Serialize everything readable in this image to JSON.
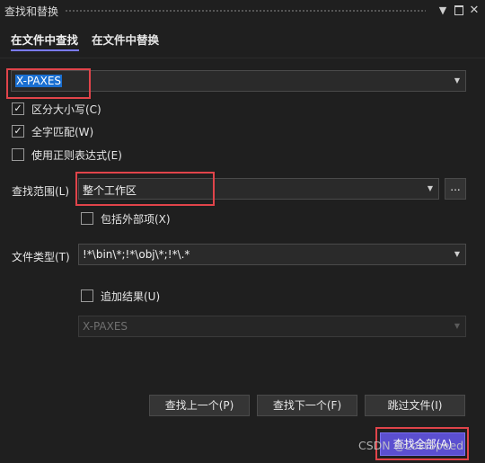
{
  "title": "查找和替换",
  "titlebar_icons": [
    "chevron-down-icon",
    "maximize-icon",
    "close-icon"
  ],
  "tabs": [
    {
      "label": "在文件中查找",
      "active": true
    },
    {
      "label": "在文件中替换",
      "active": false
    }
  ],
  "search": {
    "value": "X-PAXES"
  },
  "options": {
    "match_case": {
      "label": "区分大小写(C)",
      "checked": true
    },
    "whole_word": {
      "label": "全字匹配(W)",
      "checked": true
    },
    "regex": {
      "label": "使用正则表达式(E)",
      "checked": false
    }
  },
  "scope": {
    "label": "查找范围(L)",
    "value": "整个工作区",
    "browse_label": "...",
    "include_external": {
      "label": "包括外部项(X)",
      "checked": false
    }
  },
  "file_types": {
    "label": "文件类型(T)",
    "value": "!*\\bin\\*;!*\\obj\\*;!*\\.*"
  },
  "append_results": {
    "label": "追加结果(U)",
    "checked": false,
    "disabled_value": "X-PAXES"
  },
  "buttons": {
    "find_prev": "查找上一个(P)",
    "find_next": "查找下一个(F)",
    "skip_file": "跳过文件(I)",
    "find_all": "查找全部(A)"
  },
  "watermark": "CSDN @LostSpeed",
  "colors": {
    "background": "#1f1f1f",
    "accent": "#5b4fd0",
    "highlight": "#e0444a",
    "selection": "#1a6fd1"
  }
}
